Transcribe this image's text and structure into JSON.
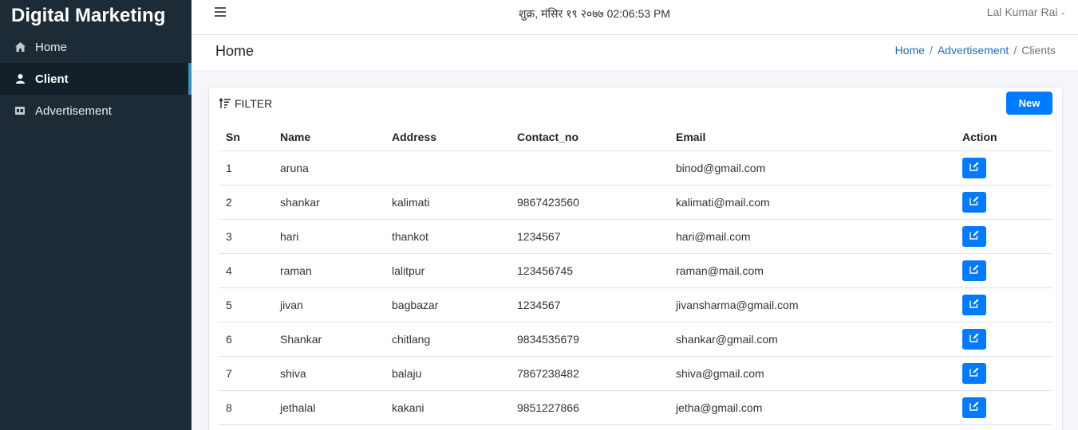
{
  "brand": "Digital Marketing",
  "sidebar": {
    "items": [
      {
        "label": "Home",
        "icon": "home-icon"
      },
      {
        "label": "Client",
        "icon": "user-icon",
        "active": true
      },
      {
        "label": "Advertisement",
        "icon": "ad-icon"
      }
    ]
  },
  "topbar": {
    "datetime": "शुक्र, मंसिर १९ २०७७ 02:06:53 PM",
    "user": "Lal Kumar Rai"
  },
  "header": {
    "title": "Home",
    "breadcrumb": [
      "Home",
      "Advertisement",
      "Clients"
    ]
  },
  "card": {
    "filter_label": "FILTER",
    "new_label": "New"
  },
  "table": {
    "columns": [
      "Sn",
      "Name",
      "Address",
      "Contact_no",
      "Email",
      "Action"
    ],
    "rows": [
      {
        "sn": "1",
        "name": "aruna",
        "address": "",
        "contact": "",
        "email": "binod@gmail.com"
      },
      {
        "sn": "2",
        "name": "shankar",
        "address": "kalimati",
        "contact": "9867423560",
        "email": "kalimati@mail.com"
      },
      {
        "sn": "3",
        "name": "hari",
        "address": "thankot",
        "contact": "1234567",
        "email": "hari@mail.com"
      },
      {
        "sn": "4",
        "name": "raman",
        "address": "lalitpur",
        "contact": "123456745",
        "email": "raman@mail.com"
      },
      {
        "sn": "5",
        "name": "jivan",
        "address": "bagbazar",
        "contact": "1234567",
        "email": "jivansharma@gmail.com"
      },
      {
        "sn": "6",
        "name": "Shankar",
        "address": "chitlang",
        "contact": "9834535679",
        "email": "shankar@gmail.com"
      },
      {
        "sn": "7",
        "name": "shiva",
        "address": "balaju",
        "contact": "7867238482",
        "email": "shiva@gmail.com"
      },
      {
        "sn": "8",
        "name": "jethalal",
        "address": "kakani",
        "contact": "9851227866",
        "email": "jetha@gmail.com"
      }
    ]
  },
  "colors": {
    "accent": "#007bff",
    "sidebar_bg": "#1c2b36",
    "active_bar": "#3c8dbc"
  }
}
